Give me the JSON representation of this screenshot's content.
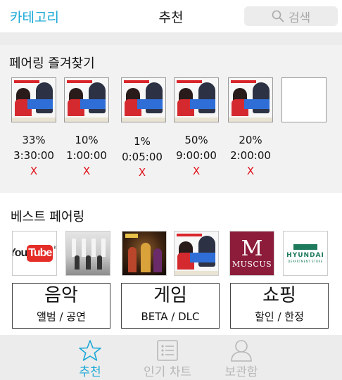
{
  "header": {
    "category_label": "카테고리",
    "title": "추천",
    "search_placeholder": "검색"
  },
  "favorites": {
    "title": "페어링 즐겨찾기",
    "items": [
      {
        "percent": "33%",
        "time": "3:30:00",
        "remove": "X"
      },
      {
        "percent": "10%",
        "time": "1:00:00",
        "remove": "X"
      },
      {
        "percent": "1%",
        "time": "0:05:00",
        "remove": "X"
      },
      {
        "percent": "50%",
        "time": "9:00:00",
        "remove": "X"
      },
      {
        "percent": "20%",
        "time": "2:00:00",
        "remove": "X"
      }
    ]
  },
  "best": {
    "title": "베스트 페어링",
    "logos": {
      "youtube": {
        "you": "You",
        "tube": "Tube",
        "region": "KR"
      },
      "muscus": {
        "mark": "M",
        "name": "MUSCUS"
      },
      "hyundai": {
        "name": "HYUNDAI",
        "sub": "DEPARTMENT STORE"
      }
    },
    "categories": [
      {
        "title": "음악",
        "subtitle": "앨범 / 공연"
      },
      {
        "title": "게임",
        "subtitle": "BETA / DLC"
      },
      {
        "title": "쇼핑",
        "subtitle": "할인 / 한정"
      }
    ]
  },
  "tabs": [
    {
      "label": "추천",
      "icon": "star-icon",
      "active": true
    },
    {
      "label": "인기 차트",
      "icon": "list-icon",
      "active": false
    },
    {
      "label": "보관함",
      "icon": "person-icon",
      "active": false
    }
  ],
  "colors": {
    "accent": "#1aa7d6",
    "remove": "#e0121a",
    "inactive_tab": "#b7b7b7"
  }
}
